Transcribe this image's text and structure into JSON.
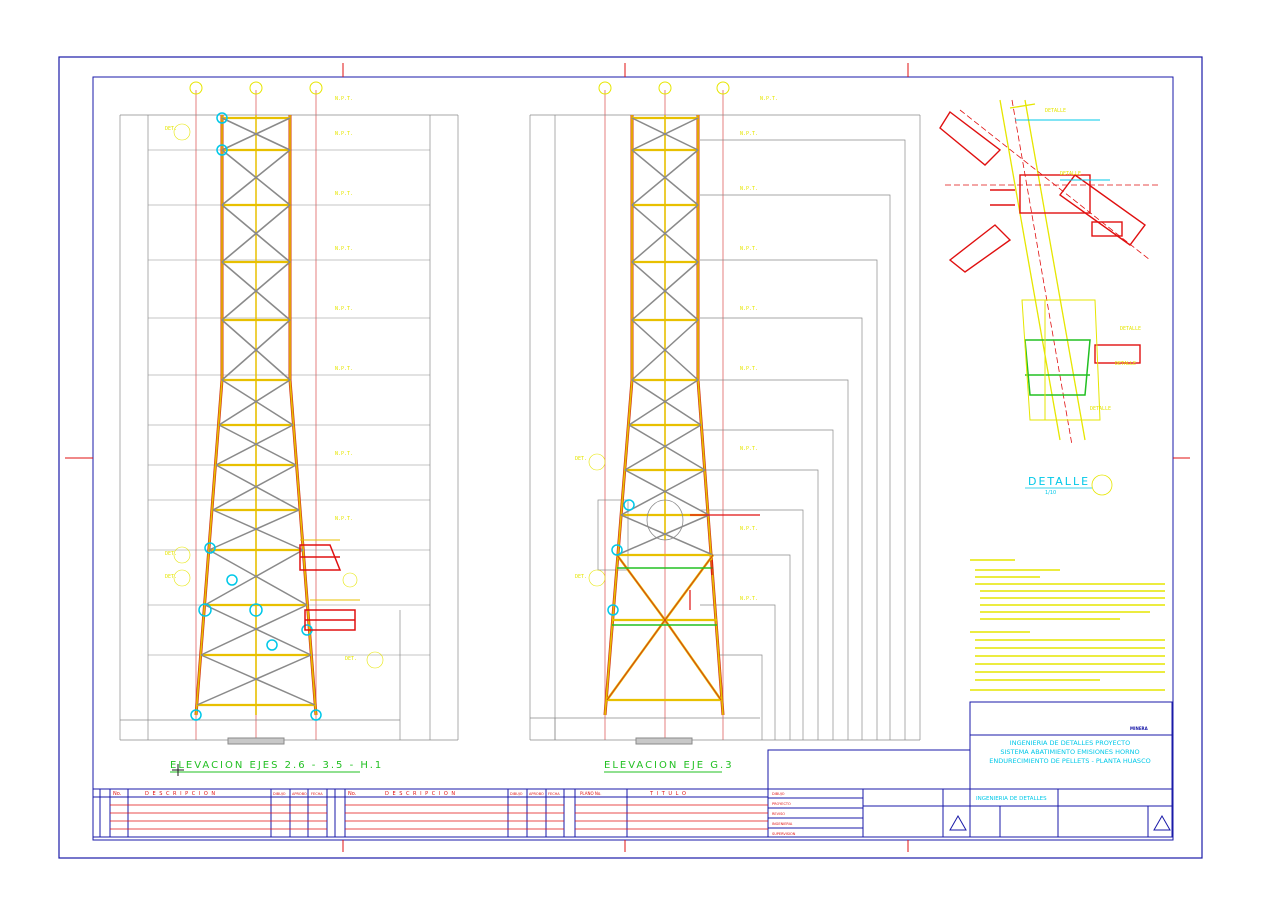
{
  "drawing": {
    "elevation_left_title": "ELEVACION EJES  2.6 - 3.5 - H.1",
    "elevation_center_title": "ELEVACION EJE  G.3",
    "detail_title": "DETALLE",
    "detail_scale": "1/10",
    "revision_header": {
      "no": "No.",
      "description": "D E S C R I P C I O N",
      "dibujo": "DIBUJO",
      "aprobo": "APROBO",
      "fecha": "FECHA"
    },
    "reference_header": {
      "plano_no": "PLANO No.",
      "titulo": "T I T U L O"
    },
    "title_block": {
      "client": "MINERA",
      "line1": "INGENIERIA DE DETALLES PROYECTO",
      "line2": "SISTEMA ABATIMIENTO EMISIONES HORNO",
      "line3": "ENDURECIMIENTO DE PELLETS - PLANTA HUASCO",
      "company": "INGENIERIA DE DETALLES",
      "roles": [
        "DIBUJO",
        "PROYECTO",
        "REVISO",
        "INGENIERIA",
        "SUPERVISION"
      ]
    }
  },
  "colors": {
    "frame": "#1a1aa8",
    "grid": "#e06060",
    "steel": "#e8c000",
    "steel_outline": "#d23a1a",
    "dims": "#e6e600",
    "cyan": "#00c8e8",
    "green": "#22c022",
    "red": "#e01010",
    "gray": "#8a8a8a"
  }
}
